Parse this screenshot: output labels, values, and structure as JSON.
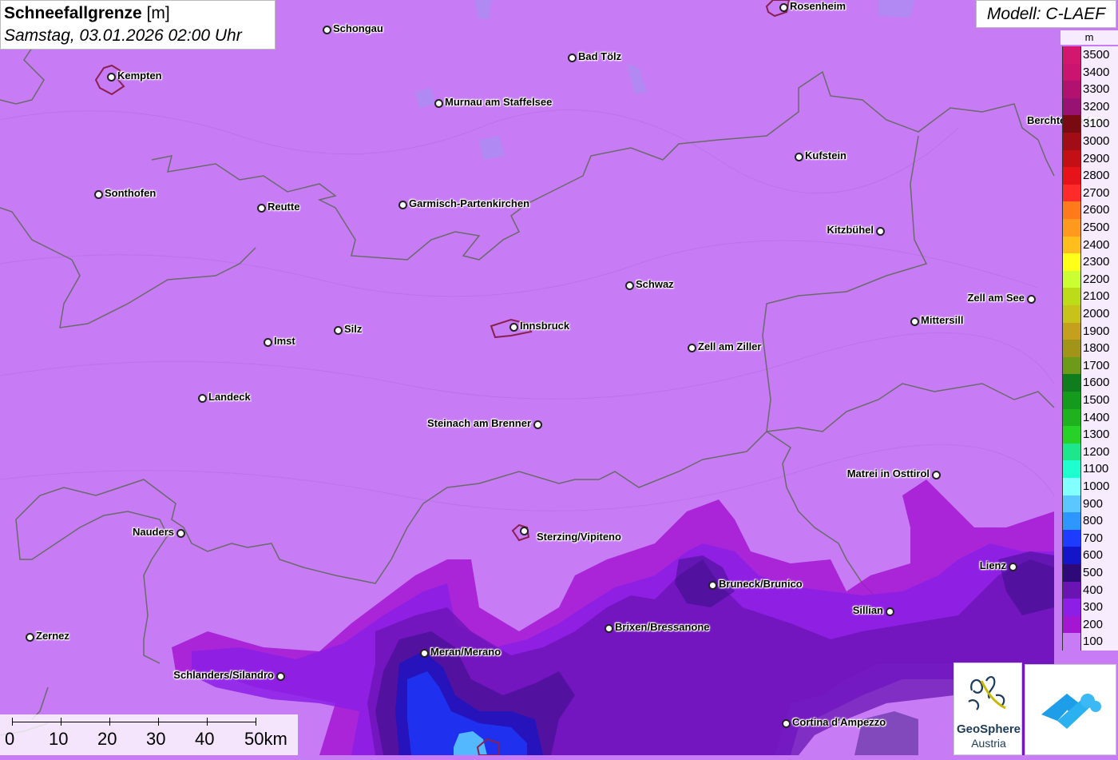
{
  "header": {
    "title": "Schneefallgrenze",
    "unit": "[m]",
    "datetime": "Samstag, 03.01.2026 02:00 Uhr",
    "model": "Modell: C-LAEF"
  },
  "legend": {
    "unit": "m",
    "entries": [
      {
        "label": "3500",
        "color": "#d4176e"
      },
      {
        "label": "3400",
        "color": "#cb1470"
      },
      {
        "label": "3300",
        "color": "#b11270"
      },
      {
        "label": "3200",
        "color": "#971272"
      },
      {
        "label": "3100",
        "color": "#7a0a12"
      },
      {
        "label": "3000",
        "color": "#a00d14"
      },
      {
        "label": "2900",
        "color": "#c21015"
      },
      {
        "label": "2800",
        "color": "#e6141a"
      },
      {
        "label": "2700",
        "color": "#ff2a2a"
      },
      {
        "label": "2600",
        "color": "#ff7a1a"
      },
      {
        "label": "2500",
        "color": "#ff9a1e"
      },
      {
        "label": "2400",
        "color": "#ffbe1e"
      },
      {
        "label": "2300",
        "color": "#ffff1a"
      },
      {
        "label": "2200",
        "color": "#ccff33"
      },
      {
        "label": "2100",
        "color": "#bcdc1a"
      },
      {
        "label": "2000",
        "color": "#c8c31a"
      },
      {
        "label": "1900",
        "color": "#c4a01e"
      },
      {
        "label": "1800",
        "color": "#a19418"
      },
      {
        "label": "1700",
        "color": "#6e9a1a"
      },
      {
        "label": "1600",
        "color": "#0f7d1e"
      },
      {
        "label": "1500",
        "color": "#149b1e"
      },
      {
        "label": "1400",
        "color": "#1eb21e"
      },
      {
        "label": "1300",
        "color": "#26d226"
      },
      {
        "label": "1200",
        "color": "#1ee68c"
      },
      {
        "label": "1100",
        "color": "#1effcf"
      },
      {
        "label": "1000",
        "color": "#82ffff"
      },
      {
        "label": "900",
        "color": "#5ac8ff"
      },
      {
        "label": "800",
        "color": "#2d96ff"
      },
      {
        "label": "700",
        "color": "#1e3cff"
      },
      {
        "label": "600",
        "color": "#1414c8"
      },
      {
        "label": "500",
        "color": "#2d0a78"
      },
      {
        "label": "400",
        "color": "#6a14b4"
      },
      {
        "label": "300",
        "color": "#8c1ee6"
      },
      {
        "label": "200",
        "color": "#a516d2"
      },
      {
        "label": "100",
        "color": "#c77cf5"
      }
    ]
  },
  "cities": [
    {
      "name": "Schongau",
      "dot": "left"
    },
    {
      "name": "Rosenheim",
      "dot": "left"
    },
    {
      "name": "Kempten",
      "dot": "left"
    },
    {
      "name": "Bad Tölz",
      "dot": "left"
    },
    {
      "name": "Murnau am Staffelsee",
      "dot": "left"
    },
    {
      "name": "Berchtesgaden",
      "dot": "left"
    },
    {
      "name": "Kufstein",
      "dot": "left"
    },
    {
      "name": "Sonthofen",
      "dot": "left"
    },
    {
      "name": "Reutte",
      "dot": "left"
    },
    {
      "name": "Garmisch-Partenkirchen",
      "dot": "left"
    },
    {
      "name": "Kitzbühel",
      "dot": "right"
    },
    {
      "name": "Schwaz",
      "dot": "left"
    },
    {
      "name": "Zell am See",
      "dot": "right"
    },
    {
      "name": "Mittersill",
      "dot": "left"
    },
    {
      "name": "Innsbruck",
      "dot": "left"
    },
    {
      "name": "Silz",
      "dot": "left"
    },
    {
      "name": "Imst",
      "dot": "left"
    },
    {
      "name": "Zell am Ziller",
      "dot": "left"
    },
    {
      "name": "Landeck",
      "dot": "left"
    },
    {
      "name": "Steinach am Brenner",
      "dot": "right"
    },
    {
      "name": "Matrei in Osttirol",
      "dot": "right"
    },
    {
      "name": "Nauders",
      "dot": "right"
    },
    {
      "name": "Sterzing/Vipiteno",
      "dot": "left"
    },
    {
      "name": "Lienz",
      "dot": "right"
    },
    {
      "name": "Bruneck/Brunico",
      "dot": "left"
    },
    {
      "name": "Sillian",
      "dot": "right"
    },
    {
      "name": "Brixen/Bressanone",
      "dot": "left"
    },
    {
      "name": "Zernez",
      "dot": "left"
    },
    {
      "name": "Meran/Merano",
      "dot": "left"
    },
    {
      "name": "Schlanders/Silandro",
      "dot": "right"
    },
    {
      "name": "Cortina d'Ampezzo",
      "dot": "left"
    }
  ],
  "scale": {
    "labels": [
      "0",
      "10",
      "20",
      "30",
      "40",
      "50km"
    ]
  },
  "logos": {
    "geosphere_name": "GeoSphere",
    "geosphere_sub": "Austria"
  }
}
